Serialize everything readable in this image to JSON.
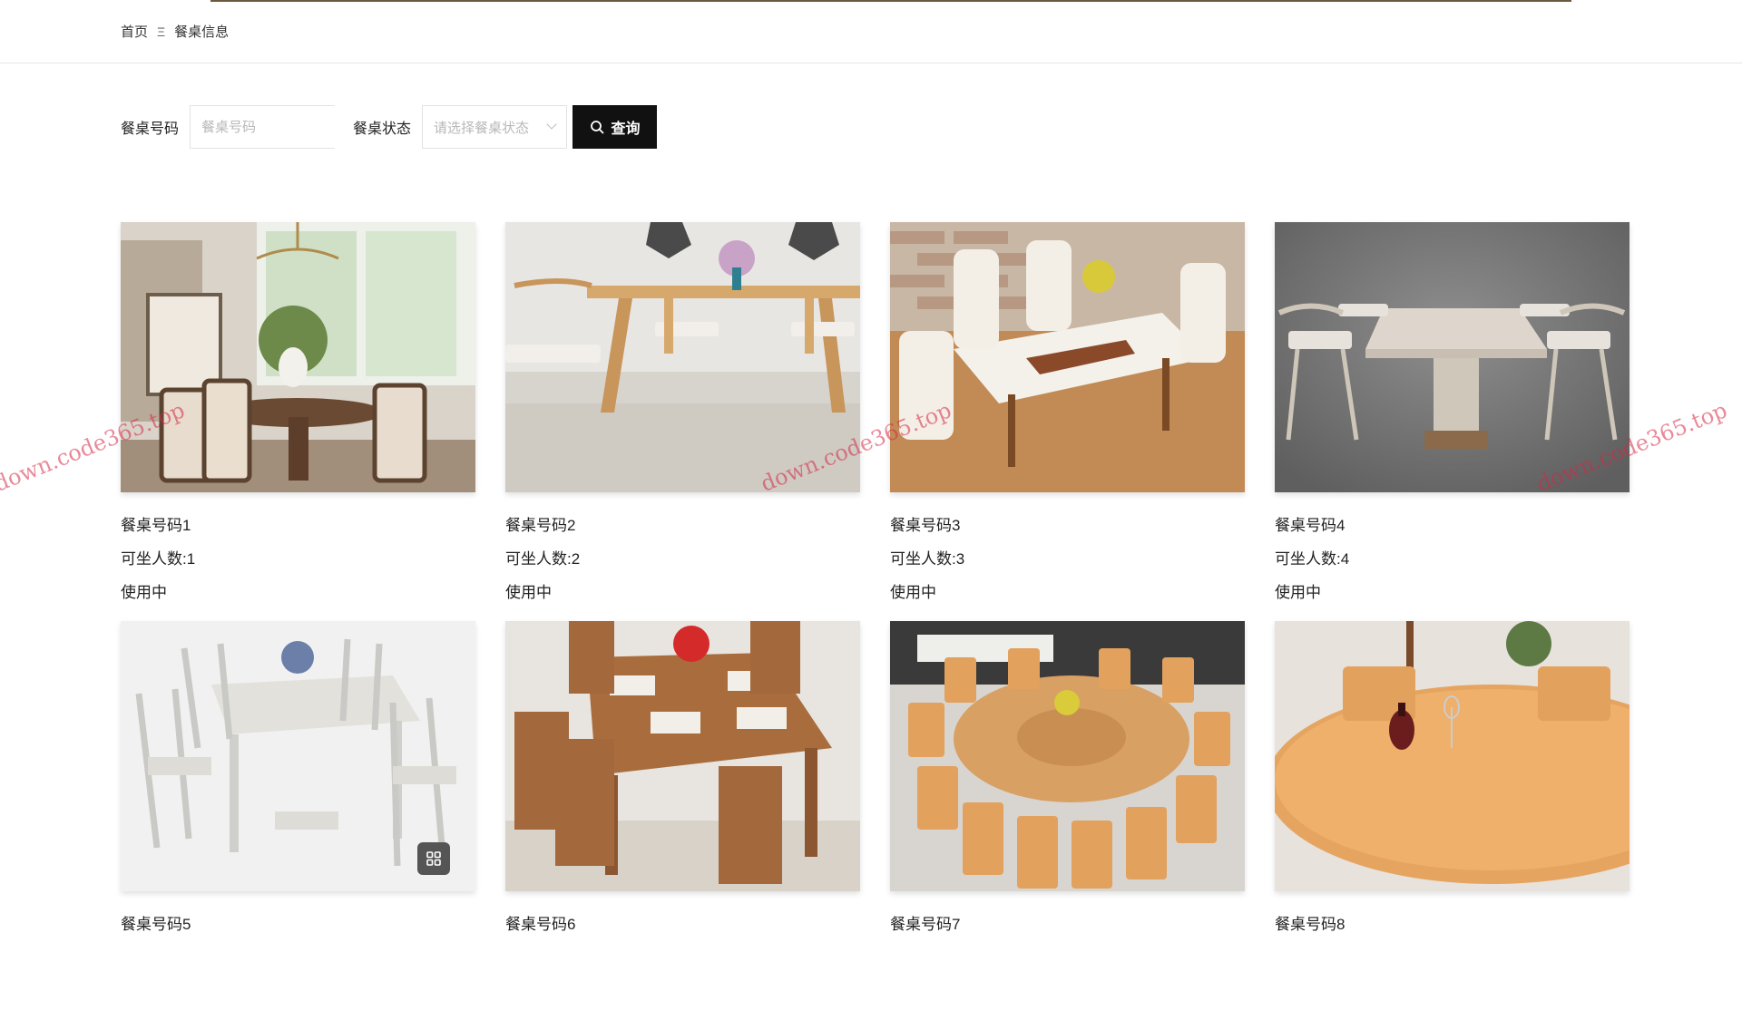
{
  "breadcrumb": {
    "home": "首页",
    "separator": "Ξ",
    "current": "餐桌信息"
  },
  "filters": {
    "table_number_label": "餐桌号码",
    "table_number_placeholder": "餐桌号码",
    "status_label": "餐桌状态",
    "status_placeholder": "请选择餐桌状态",
    "search_label": "查询"
  },
  "tables": [
    {
      "name": "餐桌号码1",
      "seats": "可坐人数:1",
      "status": "使用中"
    },
    {
      "name": "餐桌号码2",
      "seats": "可坐人数:2",
      "status": "使用中"
    },
    {
      "name": "餐桌号码3",
      "seats": "可坐人数:3",
      "status": "使用中"
    },
    {
      "name": "餐桌号码4",
      "seats": "可坐人数:4",
      "status": "使用中"
    },
    {
      "name": "餐桌号码5",
      "seats": "",
      "status": ""
    },
    {
      "name": "餐桌号码6",
      "seats": "",
      "status": ""
    },
    {
      "name": "餐桌号码7",
      "seats": "",
      "status": ""
    },
    {
      "name": "餐桌号码8",
      "seats": "",
      "status": ""
    }
  ],
  "watermark": "down.code365.top",
  "colors": {
    "accent": "#111111",
    "watermark": "#d62846"
  }
}
